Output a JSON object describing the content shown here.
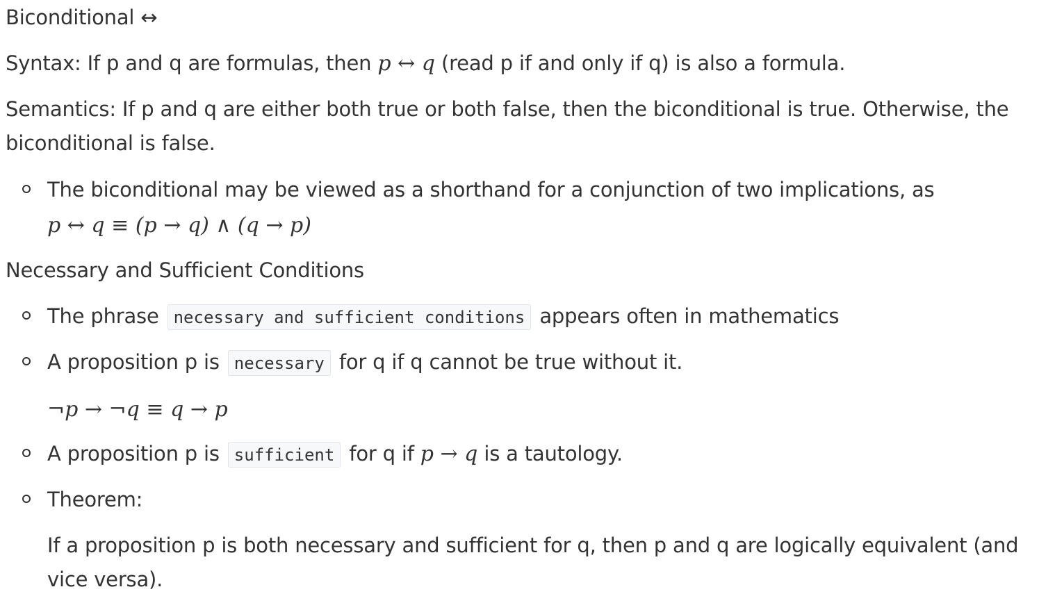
{
  "heading_biconditional": "Biconditional ↔",
  "syntax": {
    "prefix": "Syntax: If p and q are formulas, then ",
    "math": "p ↔ q",
    "suffix": " (read p if and only if q) is also a formula."
  },
  "semantics": {
    "line1": "Semantics: If p and q are either both true or both false, then the biconditional is true. Otherwise, the",
    "line2": "biconditional is false."
  },
  "biconditional_bullet": {
    "text": "The biconditional may be viewed as a shorthand for a conjunction of two implications, as",
    "math": "p ↔ q ≡ (p → q) ∧ (q → p)"
  },
  "heading_conditions": "Necessary and Sufficient Conditions",
  "phrase_bullet": {
    "prefix": "The phrase ",
    "code": "necessary and sufficient conditions",
    "suffix": " appears often in mathematics"
  },
  "necessary_bullet": {
    "prefix": "A proposition p is ",
    "code": "necessary",
    "suffix": " for q if q cannot be true without it."
  },
  "necessary_math": "¬p → ¬q ≡ q → p",
  "sufficient_bullet": {
    "prefix": "A proposition p is ",
    "code": "sufficient",
    "middle": " for q if ",
    "math": "p → q",
    "suffix": " is a tautology."
  },
  "theorem_bullet": "Theorem:",
  "theorem_text": {
    "line1": "If a proposition p is both necessary and sufficient for q, then p and q are logically equivalent (and",
    "line2": "vice versa)."
  }
}
